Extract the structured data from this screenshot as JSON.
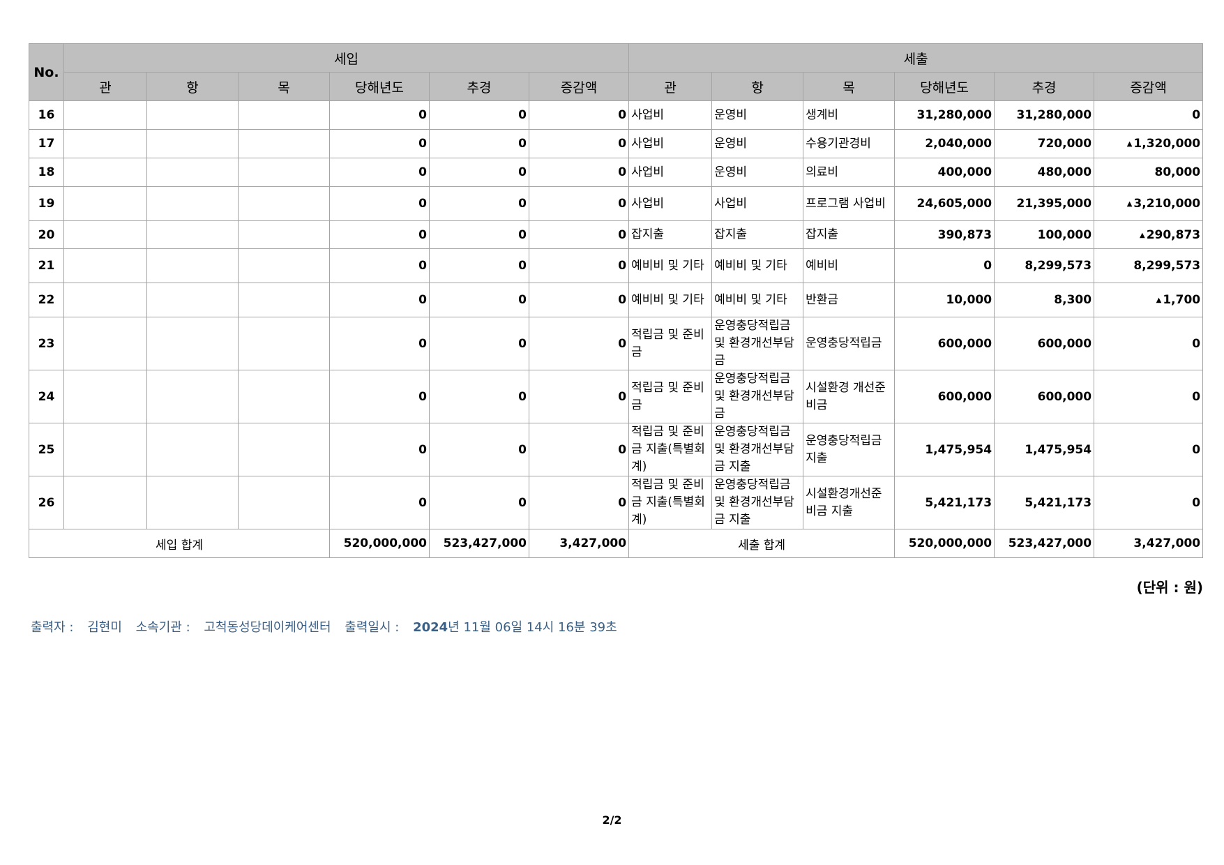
{
  "table": {
    "header": {
      "no": "No.",
      "income_group": "세입",
      "expense_group": "세출",
      "income_cols": [
        "관",
        "항",
        "목",
        "당해년도",
        "추경",
        "증감액"
      ],
      "expense_cols": [
        "관",
        "항",
        "목",
        "당해년도",
        "추경",
        "증감액"
      ]
    },
    "rows": [
      {
        "no": "16",
        "in_base": "0",
        "in_supp": "0",
        "in_diff": "0",
        "gwan": "사업비",
        "hang": "운영비",
        "mok": "생계비",
        "ex_base": "31,280,000",
        "ex_supp": "31,280,000",
        "ex_diff": "0",
        "neg": false
      },
      {
        "no": "17",
        "in_base": "0",
        "in_supp": "0",
        "in_diff": "0",
        "gwan": "사업비",
        "hang": "운영비",
        "mok": "수용기관경비",
        "ex_base": "2,040,000",
        "ex_supp": "720,000",
        "ex_diff": "1,320,000",
        "neg": true
      },
      {
        "no": "18",
        "in_base": "0",
        "in_supp": "0",
        "in_diff": "0",
        "gwan": "사업비",
        "hang": "운영비",
        "mok": "의료비",
        "ex_base": "400,000",
        "ex_supp": "480,000",
        "ex_diff": "80,000",
        "neg": false
      },
      {
        "no": "19",
        "in_base": "0",
        "in_supp": "0",
        "in_diff": "0",
        "gwan": "사업비",
        "hang": "사업비",
        "mok": "프로그램 사업비",
        "ex_base": "24,605,000",
        "ex_supp": "21,395,000",
        "ex_diff": "3,210,000",
        "neg": true
      },
      {
        "no": "20",
        "in_base": "0",
        "in_supp": "0",
        "in_diff": "0",
        "gwan": "잡지출",
        "hang": "잡지출",
        "mok": "잡지출",
        "ex_base": "390,873",
        "ex_supp": "100,000",
        "ex_diff": "290,873",
        "neg": true
      },
      {
        "no": "21",
        "in_base": "0",
        "in_supp": "0",
        "in_diff": "0",
        "gwan": "예비비 및 기타",
        "hang": "예비비 및 기타",
        "mok": "예비비",
        "ex_base": "0",
        "ex_supp": "8,299,573",
        "ex_diff": "8,299,573",
        "neg": false
      },
      {
        "no": "22",
        "in_base": "0",
        "in_supp": "0",
        "in_diff": "0",
        "gwan": "예비비 및 기타",
        "hang": "예비비 및 기타",
        "mok": "반환금",
        "ex_base": "10,000",
        "ex_supp": "8,300",
        "ex_diff": "1,700",
        "neg": true
      },
      {
        "no": "23",
        "in_base": "0",
        "in_supp": "0",
        "in_diff": "0",
        "gwan": "적립금 및 준비금",
        "hang": "운영충당적립금 및 환경개선부담금",
        "mok": "운영충당적립금",
        "ex_base": "600,000",
        "ex_supp": "600,000",
        "ex_diff": "0",
        "neg": false
      },
      {
        "no": "24",
        "in_base": "0",
        "in_supp": "0",
        "in_diff": "0",
        "gwan": "적립금 및 준비금",
        "hang": "운영충당적립금 및 환경개선부담금",
        "mok": "시설환경 개선준비금",
        "ex_base": "600,000",
        "ex_supp": "600,000",
        "ex_diff": "0",
        "neg": false
      },
      {
        "no": "25",
        "in_base": "0",
        "in_supp": "0",
        "in_diff": "0",
        "gwan": "적립금 및 준비금 지출(특별회계)",
        "hang": "운영충당적립금 및 환경개선부담금 지출",
        "mok": "운영충당적립금 지출",
        "ex_base": "1,475,954",
        "ex_supp": "1,475,954",
        "ex_diff": "0",
        "neg": false
      },
      {
        "no": "26",
        "in_base": "0",
        "in_supp": "0",
        "in_diff": "0",
        "gwan": "적립금 및 준비금 지출(특별회계)",
        "hang": "운영충당적립금 및 환경개선부담금 지출",
        "mok": "시설환경개선준비금 지출",
        "ex_base": "5,421,173",
        "ex_supp": "5,421,173",
        "ex_diff": "0",
        "neg": false
      }
    ],
    "total": {
      "income_label": "세입 합계",
      "in_base": "520,000,000",
      "in_supp": "523,427,000",
      "in_diff": "3,427,000",
      "expense_label": "세출 합계",
      "ex_base": "520,000,000",
      "ex_supp": "523,427,000",
      "ex_diff": "3,427,000"
    },
    "negative_marker": "▲"
  },
  "unit_note": "(단위 : 원)",
  "footer": {
    "printer_label": "출력자 :",
    "printer": "김현미",
    "org_label": "소속기관 :",
    "org": "고척동성당데이케어센터",
    "printed_at_label": "출력일시 :",
    "year": "2024",
    "printed_at_rest": "년 11월 06일 14시 16분 39초"
  },
  "page_number": "2/2"
}
